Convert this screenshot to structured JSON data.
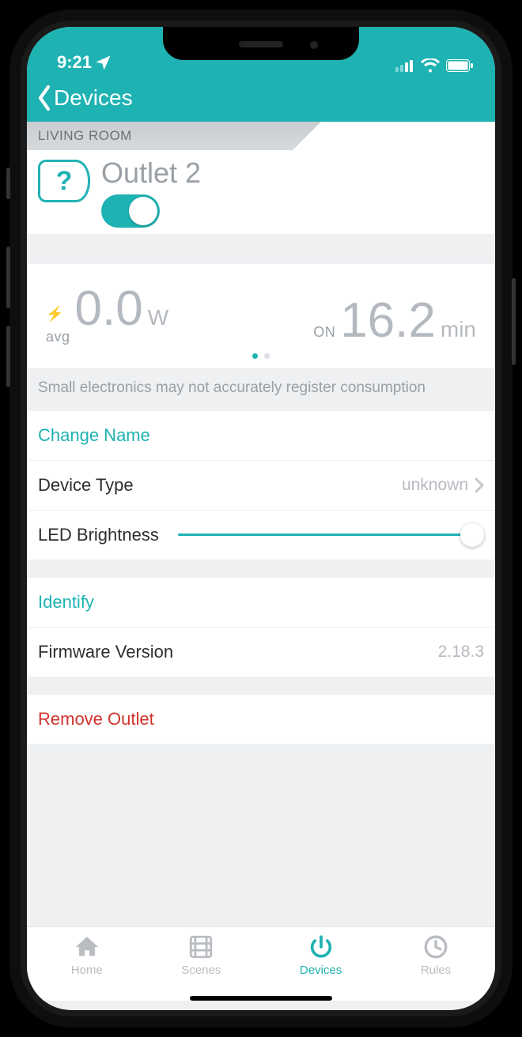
{
  "statusbar": {
    "time": "9:21"
  },
  "nav": {
    "back_label": "Devices"
  },
  "room": {
    "name": "LIVING ROOM"
  },
  "outlet": {
    "name": "Outlet 2",
    "toggle_on": true
  },
  "stats": {
    "avg_pre": "avg",
    "avg_value": "0.0",
    "avg_unit": "W",
    "on_pre": "ON",
    "on_value": "16.2",
    "on_unit": "min",
    "note": "Small electronics may not accurately register consumption"
  },
  "settings": {
    "change_name_label": "Change Name",
    "device_type_label": "Device Type",
    "device_type_value": "unknown",
    "led_label": "LED Brightness",
    "identify_label": "Identify",
    "firmware_label": "Firmware Version",
    "firmware_value": "2.18.3",
    "remove_label": "Remove Outlet"
  },
  "tabs": {
    "home": "Home",
    "scenes": "Scenes",
    "devices": "Devices",
    "rules": "Rules"
  }
}
